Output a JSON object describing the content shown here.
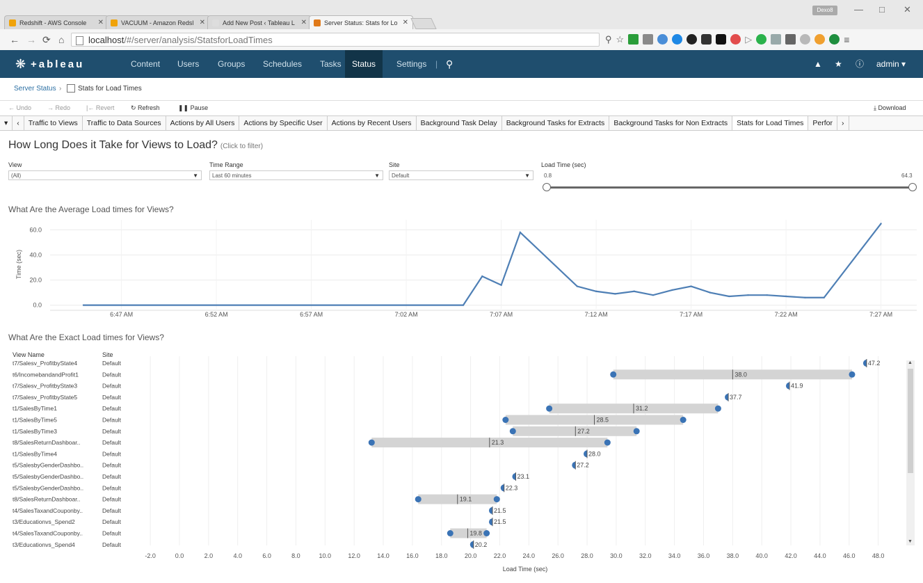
{
  "browser": {
    "tabs": [
      {
        "title": "Redshift - AWS Console",
        "color": "#f0a30a"
      },
      {
        "title": "VACUUM - Amazon Redsl",
        "color": "#f0a30a"
      },
      {
        "title": "Add New Post ‹ Tableau L",
        "color": "#dddddd"
      },
      {
        "title": "Server Status: Stats for Lo",
        "color": "#e07a1a"
      }
    ],
    "user_chip": "Dexo8",
    "url_host": "localhost",
    "url_path": "/#/server/analysis/StatsforLoadTimes"
  },
  "nav": {
    "logo": "+ableau",
    "items": [
      "Content",
      "Users",
      "Groups",
      "Schedules",
      "Tasks",
      "Status",
      "Settings"
    ],
    "active": "Status",
    "user": "admin"
  },
  "breadcrumb": {
    "root": "Server Status",
    "current": "Stats for Load Times"
  },
  "toolbar": {
    "undo": "Undo",
    "redo": "Redo",
    "revert": "Revert",
    "refresh": "Refresh",
    "pause": "Pause",
    "download": "Download"
  },
  "sheet_tabs": [
    "Traffic to Views",
    "Traffic to Data Sources",
    "Actions by All Users",
    "Actions by Specific User",
    "Actions by Recent Users",
    "Background Task Delay",
    "Background Tasks for Extracts",
    "Background Tasks for Non Extracts",
    "Stats for Load Times",
    "Perfor"
  ],
  "active_sheet": "Stats for Load Times",
  "dashboard": {
    "title": "How Long Does it Take for Views to Load?",
    "title_hint": "(Click to filter)",
    "filters": [
      {
        "label": "View",
        "value": "(All)"
      },
      {
        "label": "Time Range",
        "value": "Last 60 minutes"
      },
      {
        "label": "Site",
        "value": "Default"
      }
    ],
    "range": {
      "label": "Load Time (sec)",
      "min": "0.8",
      "max": "64.3"
    }
  },
  "line_section_title": "What Are the Average Load times for Views?",
  "exact_section_title": "What Are the Exact Load times for Views?",
  "exact_headers": {
    "view": "View Name",
    "site": "Site"
  },
  "chart_data": [
    {
      "type": "line",
      "title": "What Are the Average Load times for Views?",
      "xlabel": "",
      "ylabel": "Time (sec)",
      "ylim": [
        -3,
        68
      ],
      "yticks": [
        "60.0",
        "40.0",
        "20.0",
        "0.0"
      ],
      "x_ticks": [
        "6:47 AM",
        "6:52 AM",
        "6:57 AM",
        "7:02 AM",
        "7:07 AM",
        "7:12 AM",
        "7:17 AM",
        "7:22 AM",
        "7:27 AM"
      ],
      "x_minutes": [
        -2,
        18,
        19,
        20,
        21,
        24,
        25,
        26,
        27,
        28,
        29,
        30,
        31,
        32,
        33,
        34,
        35,
        36,
        37,
        40
      ],
      "values": [
        0,
        0,
        23,
        16,
        58,
        15,
        11,
        9,
        11,
        8,
        12,
        15,
        10,
        7,
        8,
        8,
        7,
        6,
        6,
        65
      ],
      "grid": true
    },
    {
      "type": "gantt",
      "title": "What Are the Exact Load times for Views?",
      "xlabel": "Load Time (sec)",
      "xlim": [
        -3,
        50
      ],
      "xticks": [
        "-2.0",
        "0.0",
        "2.0",
        "4.0",
        "6.0",
        "8.0",
        "10.0",
        "12.0",
        "14.0",
        "16.0",
        "18.0",
        "20.0",
        "22.0",
        "24.0",
        "26.0",
        "28.0",
        "30.0",
        "32.0",
        "34.0",
        "36.0",
        "38.0",
        "40.0",
        "42.0",
        "44.0",
        "46.0",
        "48.0"
      ],
      "rows": [
        {
          "view": "t7/Salesv_ProfitbyState4",
          "site": "Default",
          "min": 47.2,
          "max": 47.2,
          "avg": 47.2,
          "label": "47.2"
        },
        {
          "view": "t6/IncomebandandProfit1",
          "site": "Default",
          "min": 29.8,
          "max": 46.2,
          "avg": 38.0,
          "label": "38.0"
        },
        {
          "view": "t7/Salesv_ProfitbyState3",
          "site": "Default",
          "min": 41.9,
          "max": 41.9,
          "avg": 41.9,
          "label": "41.9"
        },
        {
          "view": "t7/Salesv_ProfitbyState5",
          "site": "Default",
          "min": 37.7,
          "max": 37.7,
          "avg": 37.7,
          "label": "37.7"
        },
        {
          "view": "t1/SalesByTime1",
          "site": "Default",
          "min": 25.4,
          "max": 37.0,
          "avg": 31.2,
          "label": "31.2"
        },
        {
          "view": "t1/SalesByTime5",
          "site": "Default",
          "min": 22.4,
          "max": 34.6,
          "avg": 28.5,
          "label": "28.5"
        },
        {
          "view": "t1/SalesByTime3",
          "site": "Default",
          "min": 22.9,
          "max": 31.4,
          "avg": 27.2,
          "label": "27.2"
        },
        {
          "view": "t8/SalesReturnDashboar..",
          "site": "Default",
          "min": 13.2,
          "max": 29.4,
          "avg": 21.3,
          "label": "21.3"
        },
        {
          "view": "t1/SalesByTime4",
          "site": "Default",
          "min": 28.0,
          "max": 28.0,
          "avg": 28.0,
          "label": "28.0"
        },
        {
          "view": "t5/SalesbyGenderDashbo..",
          "site": "Default",
          "min": 27.2,
          "max": 27.2,
          "avg": 27.2,
          "label": "27.2"
        },
        {
          "view": "t5/SalesbyGenderDashbo..",
          "site": "Default",
          "min": 23.1,
          "max": 23.1,
          "avg": 23.1,
          "label": "23.1"
        },
        {
          "view": "t5/SalesbyGenderDashbo..",
          "site": "Default",
          "min": 22.3,
          "max": 22.3,
          "avg": 22.3,
          "label": "22.3"
        },
        {
          "view": "t8/SalesReturnDashboar..",
          "site": "Default",
          "min": 16.4,
          "max": 21.8,
          "avg": 19.1,
          "label": "19.1"
        },
        {
          "view": "t4/SalesTaxandCouponby..",
          "site": "Default",
          "min": 21.5,
          "max": 21.5,
          "avg": 21.5,
          "label": "21.5"
        },
        {
          "view": "t3/Educationvs_Spend2",
          "site": "Default",
          "min": 21.5,
          "max": 21.5,
          "avg": 21.5,
          "label": "21.5"
        },
        {
          "view": "t4/SalesTaxandCouponby..",
          "site": "Default",
          "min": 18.6,
          "max": 21.1,
          "avg": 19.8,
          "label": "19.8"
        },
        {
          "view": "t3/Educationvs_Spend4",
          "site": "Default",
          "min": 20.2,
          "max": 20.2,
          "avg": 20.2,
          "label": "20.2"
        }
      ],
      "colors": {
        "dot": "#3a73b5",
        "band": "#d4d4d4"
      }
    }
  ]
}
